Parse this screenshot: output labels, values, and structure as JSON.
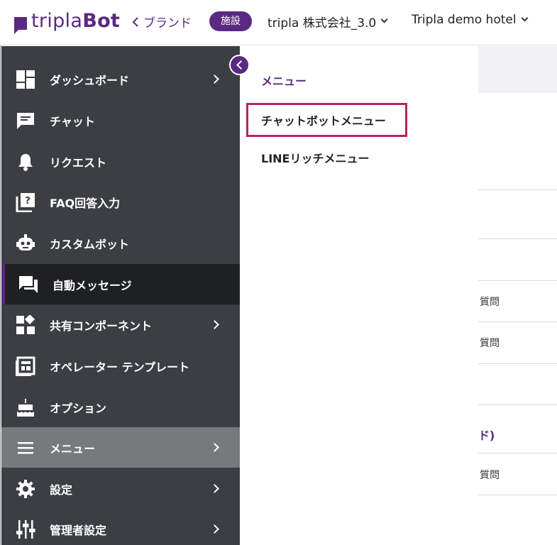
{
  "header": {
    "logo_text_a": "tripla",
    "logo_text_b": "Bot",
    "brand_link": "ブランド",
    "facility_badge": "施設",
    "company_select": "tripla 株式会社_3.0",
    "hotel_select": "Tripla demo hotel"
  },
  "sidebar": {
    "items": [
      {
        "label": "ダッシュボード",
        "icon": "dashboard-icon",
        "has_submenu": true
      },
      {
        "label": "チャット",
        "icon": "chat-icon",
        "has_submenu": false
      },
      {
        "label": "リクエスト",
        "icon": "bell-icon",
        "has_submenu": false
      },
      {
        "label": "FAQ回答入力",
        "icon": "faq-icon",
        "has_submenu": false
      },
      {
        "label": "カスタムボット",
        "icon": "robot-icon",
        "has_submenu": false
      },
      {
        "label": "自動メッセージ",
        "icon": "message-icon",
        "has_submenu": false,
        "active": true
      },
      {
        "label": "共有コンポーネント",
        "icon": "components-icon",
        "has_submenu": true
      },
      {
        "label": "オペレーター テンプレート",
        "icon": "template-icon",
        "has_submenu": false
      },
      {
        "label": "オプション",
        "icon": "cake-icon",
        "has_submenu": false
      },
      {
        "label": "メニュー",
        "icon": "menu-icon",
        "has_submenu": true,
        "selected": true
      },
      {
        "label": "設定",
        "icon": "gear-icon",
        "has_submenu": true
      },
      {
        "label": "管理者設定",
        "icon": "sliders-icon",
        "has_submenu": true
      }
    ]
  },
  "submenu": {
    "title": "メニュー",
    "items": [
      "チャットボットメニュー",
      "LINEリッチメニュー"
    ]
  },
  "background_rows": {
    "texts": [
      "質問",
      "質問",
      "ド)",
      "質問"
    ]
  },
  "colors": {
    "brand": "#5a2a82",
    "sidebar_bg": "#3b3e42",
    "highlight_border": "#b8245f"
  }
}
